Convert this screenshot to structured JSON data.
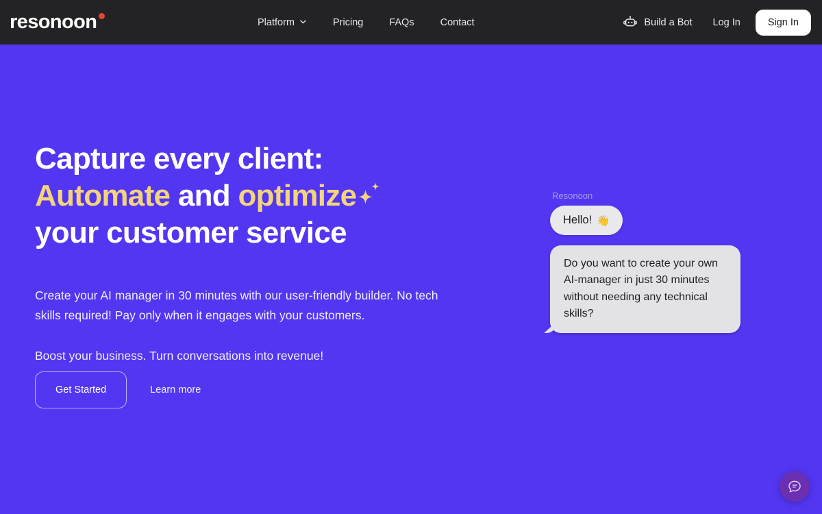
{
  "brand": {
    "name": "resonoon",
    "dot_color": "#E8462E"
  },
  "colors": {
    "header_bg": "#232325",
    "hero_bg": "#5336F2",
    "accent_yellow": "#F3D47E",
    "bubble_gray": "#E9E9EB",
    "widget_purple": "#6B2FB2"
  },
  "header": {
    "nav": [
      {
        "label": "Platform",
        "has_chevron": true,
        "icon": "chevron-down-icon"
      },
      {
        "label": "Pricing",
        "has_chevron": false
      },
      {
        "label": "FAQs",
        "has_chevron": false
      },
      {
        "label": "Contact",
        "has_chevron": false
      }
    ],
    "build_bot": {
      "label": "Build a Bot",
      "icon": "robot-icon"
    },
    "login_label": "Log In",
    "signin_label": "Sign In"
  },
  "hero": {
    "headline": {
      "line1": "Capture every client:",
      "line2_a": "Automate",
      "line2_b": " and ",
      "line2_c": "optimize",
      "sparkle_icon": "sparkle-icon",
      "line3": "your customer service"
    },
    "body_paragraph_1": "Create your AI manager in 30 minutes with our user-friendly builder. No tech skills required! Pay only when it engages with your customers.",
    "body_paragraph_2": "Boost your business. Turn conversations into revenue!",
    "cta_primary": "Get Started",
    "cta_secondary": "Learn more"
  },
  "chat_preview": {
    "sender_label": "Resonoon",
    "message_1": "Hello!",
    "message_1_emoji": "👋",
    "message_2": "Do you want to create your own AI-manager in just 30 minutes without needing any technical skills?"
  },
  "chat_widget": {
    "icon": "chat-bubble-icon"
  }
}
